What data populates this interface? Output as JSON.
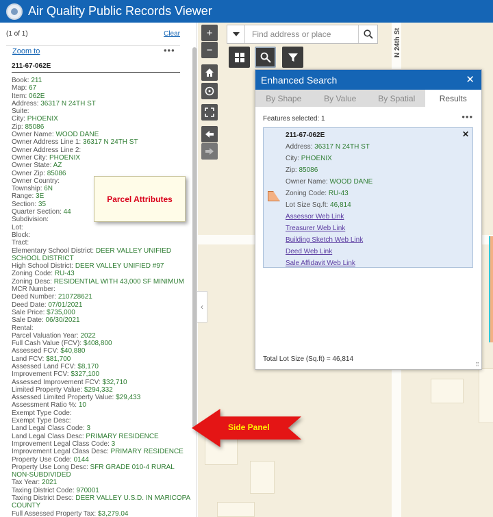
{
  "header": {
    "title": "Air Quality Public Records Viewer",
    "logo_icon": "seal-logo-icon"
  },
  "panel": {
    "count": "(1 of 1)",
    "clear_label": "Clear",
    "zoom_label": "Zoom to",
    "more_icon": "•••",
    "feature_id": "211-67-062E",
    "attributes": [
      {
        "k": "Book:",
        "v": "211"
      },
      {
        "k": "Map:",
        "v": "67"
      },
      {
        "k": "Item:",
        "v": "062E"
      },
      {
        "k": "Address:",
        "v": "36317 N 24TH ST"
      },
      {
        "k": "Suite:",
        "v": ""
      },
      {
        "k": "City:",
        "v": "PHOENIX"
      },
      {
        "k": "Zip:",
        "v": "85086"
      },
      {
        "k": "Owner Name:",
        "v": "WOOD DANE"
      },
      {
        "k": "Owner Address Line 1:",
        "v": "36317 N 24TH ST"
      },
      {
        "k": "Owner Address Line 2:",
        "v": ""
      },
      {
        "k": "Owner City:",
        "v": "PHOENIX"
      },
      {
        "k": "Owner State:",
        "v": "AZ"
      },
      {
        "k": "Owner Zip:",
        "v": "85086"
      },
      {
        "k": "Owner Country:",
        "v": ""
      },
      {
        "k": "Township:",
        "v": "6N"
      },
      {
        "k": "Range:",
        "v": "3E"
      },
      {
        "k": "Section:",
        "v": "35"
      },
      {
        "k": "Quarter Section:",
        "v": "44"
      },
      {
        "k": "Subdivision:",
        "v": ""
      },
      {
        "k": "Lot:",
        "v": ""
      },
      {
        "k": "Block:",
        "v": ""
      },
      {
        "k": "Tract:",
        "v": ""
      },
      {
        "k": "Elementary School District:",
        "v": "DEER VALLEY UNIFIED SCHOOL DISTRICT"
      },
      {
        "k": "High School District:",
        "v": "DEER VALLEY UNIFIED #97"
      },
      {
        "k": "Zoning Code:",
        "v": "RU-43"
      },
      {
        "k": "Zoning Desc:",
        "v": "RESIDENTIAL WITH 43,000 SF MINIMUM"
      },
      {
        "k": "MCR Number:",
        "v": ""
      },
      {
        "k": "Deed Number:",
        "v": "210728621"
      },
      {
        "k": "Deed Date:",
        "v": "07/01/2021"
      },
      {
        "k": "Sale Price:",
        "v": "$735,000"
      },
      {
        "k": "Sale Date:",
        "v": "06/30/2021"
      },
      {
        "k": "Rental:",
        "v": ""
      },
      {
        "k": "Parcel Valuation Year:",
        "v": "2022"
      },
      {
        "k": "Full Cash Value (FCV):",
        "v": "$408,800"
      },
      {
        "k": "Assessed FCV:",
        "v": "$40,880"
      },
      {
        "k": "Land FCV:",
        "v": "$81,700"
      },
      {
        "k": "Assessed Land FCV:",
        "v": "$8,170"
      },
      {
        "k": "Improvement FCV:",
        "v": "$327,100"
      },
      {
        "k": "Assessed Improvement FCV:",
        "v": "$32,710"
      },
      {
        "k": "Limited Property Value:",
        "v": "$294,332"
      },
      {
        "k": "Assessed Limited Property Value:",
        "v": "$29,433"
      },
      {
        "k": "Assessment Ratio %:",
        "v": "10"
      },
      {
        "k": "Exempt Type Code:",
        "v": ""
      },
      {
        "k": "Exempt Type Desc:",
        "v": ""
      },
      {
        "k": "Land Legal Class Code:",
        "v": "3"
      },
      {
        "k": "Land Legal Class Desc:",
        "v": "PRIMARY RESIDENCE"
      },
      {
        "k": "Improvement Legal Class Code:",
        "v": "3"
      },
      {
        "k": "Improvement Legal Class Desc:",
        "v": "PRIMARY RESIDENCE"
      },
      {
        "k": "Property Use Code:",
        "v": "0144"
      },
      {
        "k": "Property Use Long Desc:",
        "v": "SFR GRADE 010-4 RURAL NON-SUBDIVIDED"
      },
      {
        "k": "Tax Year:",
        "v": "2021"
      },
      {
        "k": "Taxing District Code:",
        "v": "970001"
      },
      {
        "k": "Taxing District Desc:",
        "v": "DEER VALLEY U.S.D. IN MARICOPA COUNTY"
      },
      {
        "k": "Full Assessed Property Tax:",
        "v": "$3,279.04"
      }
    ]
  },
  "callouts": {
    "parcel": "Parcel Attributes",
    "side": "Side Panel"
  },
  "map": {
    "street_label": "N 24th St",
    "search_placeholder": "Find address or place",
    "zoom_in": "+",
    "zoom_out": "−",
    "collapse_icon": "‹"
  },
  "enhanced_search": {
    "title": "Enhanced Search",
    "close_icon": "✕",
    "tabs": [
      "By Shape",
      "By Value",
      "By Spatial",
      "Results"
    ],
    "active_tab": "Results",
    "features_selected": "Features selected: 1",
    "more_icon": "•••",
    "result": {
      "id": "211-67-062E",
      "close_icon": "✕",
      "swatch_color": "#f4b183",
      "fields": [
        {
          "k": "Address:",
          "v": "36317 N 24TH ST"
        },
        {
          "k": "City:",
          "v": "PHOENIX"
        },
        {
          "k": "Zip:",
          "v": "85086"
        },
        {
          "k": "Owner Name:",
          "v": "WOOD DANE"
        },
        {
          "k": "Zoning Code:",
          "v": "RU-43"
        },
        {
          "k": "Lot Size Sq.ft:",
          "v": "46,814"
        }
      ],
      "links": [
        "Assessor Web Link",
        "Treasurer Web Link",
        "Building Sketch Web Link",
        "Deed Web Link",
        "Sale Affidavit Web Link"
      ]
    },
    "total": "Total Lot Size (Sq.ft) = 46,814"
  }
}
